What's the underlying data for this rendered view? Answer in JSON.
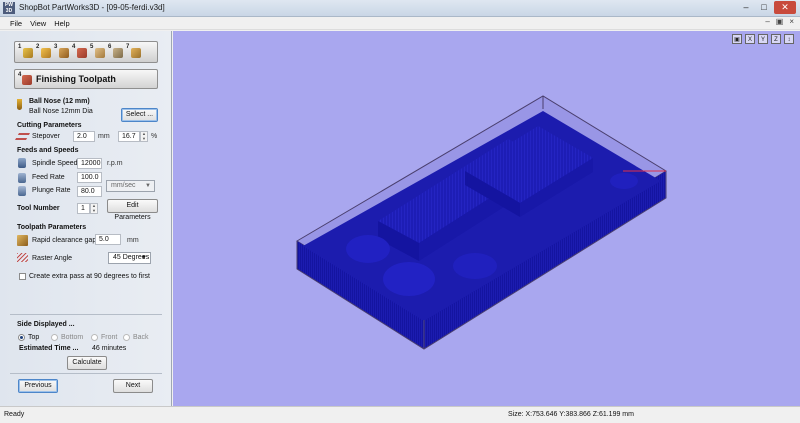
{
  "window": {
    "title": "ShopBot PartWorks3D - [09-05-ferdi.v3d]",
    "app_icon_text": "PW 3D"
  },
  "menu": {
    "items": [
      "File",
      "View",
      "Help"
    ]
  },
  "toolbox": {
    "tool_numbers": [
      "1",
      "2",
      "3",
      "4",
      "5",
      "6",
      "7"
    ]
  },
  "section": {
    "number": "4",
    "title": "Finishing Toolpath"
  },
  "tool": {
    "name": "Ball Nose (12 mm)",
    "description": "Ball Nose 12mm Dia",
    "select_label": "Select ..."
  },
  "cutting": {
    "header": "Cutting Parameters",
    "stepover_label": "Stepover",
    "stepover_value": "2.0",
    "stepover_unit": "mm",
    "stepover_percent": "16.7",
    "percent_sign": "%"
  },
  "feeds": {
    "header": "Feeds and Speeds",
    "spindle_label": "Spindle Speed",
    "spindle_value": "12000",
    "spindle_unit": "r.p.m",
    "feed_label": "Feed Rate",
    "feed_value": "100.0",
    "plunge_label": "Plunge Rate",
    "plunge_value": "80.0",
    "rate_unit": "mm/sec"
  },
  "tool_number": {
    "label": "Tool Number",
    "value": "1",
    "edit_label": "Edit Parameters"
  },
  "toolpath": {
    "header": "Toolpath Parameters",
    "clearance_label": "Rapid clearance gap",
    "clearance_value": "5.0",
    "clearance_unit": "mm",
    "raster_label": "Raster Angle",
    "raster_value": "45 Degrees",
    "extra_pass_label": "Create extra pass at 90 degrees to first"
  },
  "side": {
    "header": "Side Displayed ...",
    "options": [
      "Top",
      "Bottom",
      "Front",
      "Back"
    ],
    "selected": "Top"
  },
  "estimate": {
    "label": "Estimated Time ...",
    "value": "46 minutes",
    "calculate_label": "Calculate"
  },
  "nav": {
    "previous_label": "Previous",
    "next_label": "Next"
  },
  "view_tools": [
    "iso-view-icon",
    "x-axis-view-icon",
    "y-axis-view-icon",
    "z-axis-view-icon",
    "zoom-fit-icon"
  ],
  "status": {
    "left": "Ready",
    "coords": "Size: X:753.646 Y:383.866 Z:61.199 mm"
  },
  "colors": {
    "viewport_bg": "#a9a7ef",
    "toolpath_blue": "#1b1bb0",
    "block_edge": "#4a3f6e",
    "x_axis_red": "#e0304a"
  }
}
